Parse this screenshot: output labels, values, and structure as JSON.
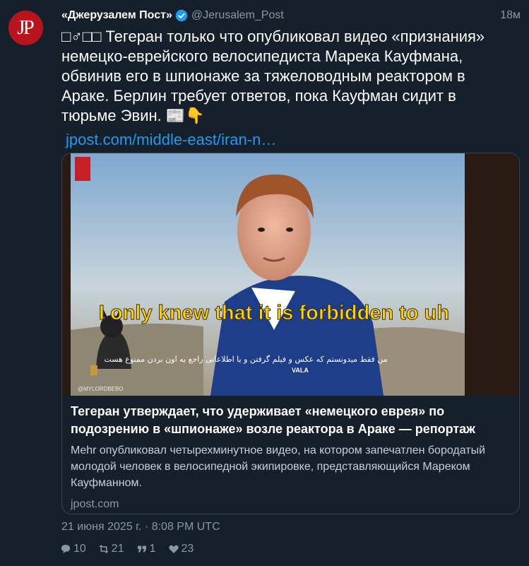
{
  "author": {
    "avatar_initials": "JP",
    "name": "«Джерузалем Пост»",
    "handle": "@Jerusalem_Post",
    "time_ago": "18м"
  },
  "tweet": {
    "text": "□♂□□ Тегеран только что опубликовал видео «признания» немецко-еврейского велосипедиста Марека Кауфмана, обвинив его в шпионаже за тяжеловодным реактором в Араке. Берлин требует ответов, пока Кауфман сидит в тюрьме Эвин. 📰👇",
    "link": "jpost.com/middle-east/iran-n…"
  },
  "card": {
    "subtitle_en": "I only knew that it is forbidden to uh",
    "subtitle_fa": "من فقط میدونستم که عکس و فیلم گرفتن و یا اطلاعاتی راجع به اون بردن ممنوع هست",
    "watermark": "@MYLORDBEBO",
    "shirt_text": "VALA",
    "title": "Тегеран утверждает, что удерживает «немецкого еврея» по подозрению в «шпионаже» возле реактора в Араке — репортаж",
    "description": "Mehr опубликовал четырехминутное видео, на котором запечатлен бородатый молодой человек в велосипедной экипировке, представляющийся Мареком Кауфманном.",
    "domain": "jpost.com"
  },
  "meta": {
    "timestamp": "21 июня 2025 г. · 8:08 PM UTC"
  },
  "actions": {
    "replies": "10",
    "retweets": "21",
    "quotes": "1",
    "likes": "23"
  },
  "colors": {
    "background": "#15202b",
    "link": "#1d9bf0",
    "secondary_text": "#8899a6",
    "verified": "#1d9bf0",
    "avatar_bg": "#b8141d"
  },
  "icons": [
    "verified-badge-icon",
    "reply-icon",
    "retweet-icon",
    "quote-icon",
    "like-icon"
  ]
}
